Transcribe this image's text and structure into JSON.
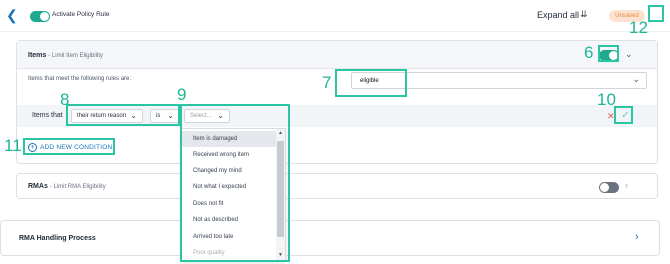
{
  "topbar": {
    "activate_label": "Activate Policy Rule",
    "expand_all": "Expand all",
    "status_badge": "Unsaved"
  },
  "items_section": {
    "title": "Items",
    "subtitle": "- Limit Item Eligibility",
    "rules_label": "Items that meet the following rules are:",
    "rules_value": "eligible",
    "items_that_label": "Items that",
    "field_select": "their return reason",
    "operator_select": "is",
    "value_placeholder": "Select...",
    "add_condition": "ADD NEW CONDITION"
  },
  "dropdown": {
    "options": [
      {
        "label": "Item is damaged",
        "state": "highlighted"
      },
      {
        "label": "Received wrong item",
        "state": "normal"
      },
      {
        "label": "Changed my mind",
        "state": "normal"
      },
      {
        "label": "Not what I expected",
        "state": "normal"
      },
      {
        "label": "Does not fit",
        "state": "normal"
      },
      {
        "label": "Not as described",
        "state": "normal"
      },
      {
        "label": "Arrived too late",
        "state": "normal"
      },
      {
        "label": "Poor quality",
        "state": "dimmed"
      }
    ]
  },
  "rma_section": {
    "title": "RMAs",
    "subtitle": "- Limit RMA Eligibility"
  },
  "handling_section": {
    "title": "RMA Handling Process"
  },
  "annotations": {
    "n6": "6",
    "n7": "7",
    "n8": "8",
    "n9": "9",
    "n10": "10",
    "n11": "11",
    "n12": "12"
  },
  "colors": {
    "accent_teal": "#1fa98f",
    "highlight_box": "#2bc4a4",
    "link_blue": "#1a73b8",
    "badge_bg": "#fde3cf",
    "badge_text": "#e08a46",
    "delete_red": "#e05353"
  }
}
